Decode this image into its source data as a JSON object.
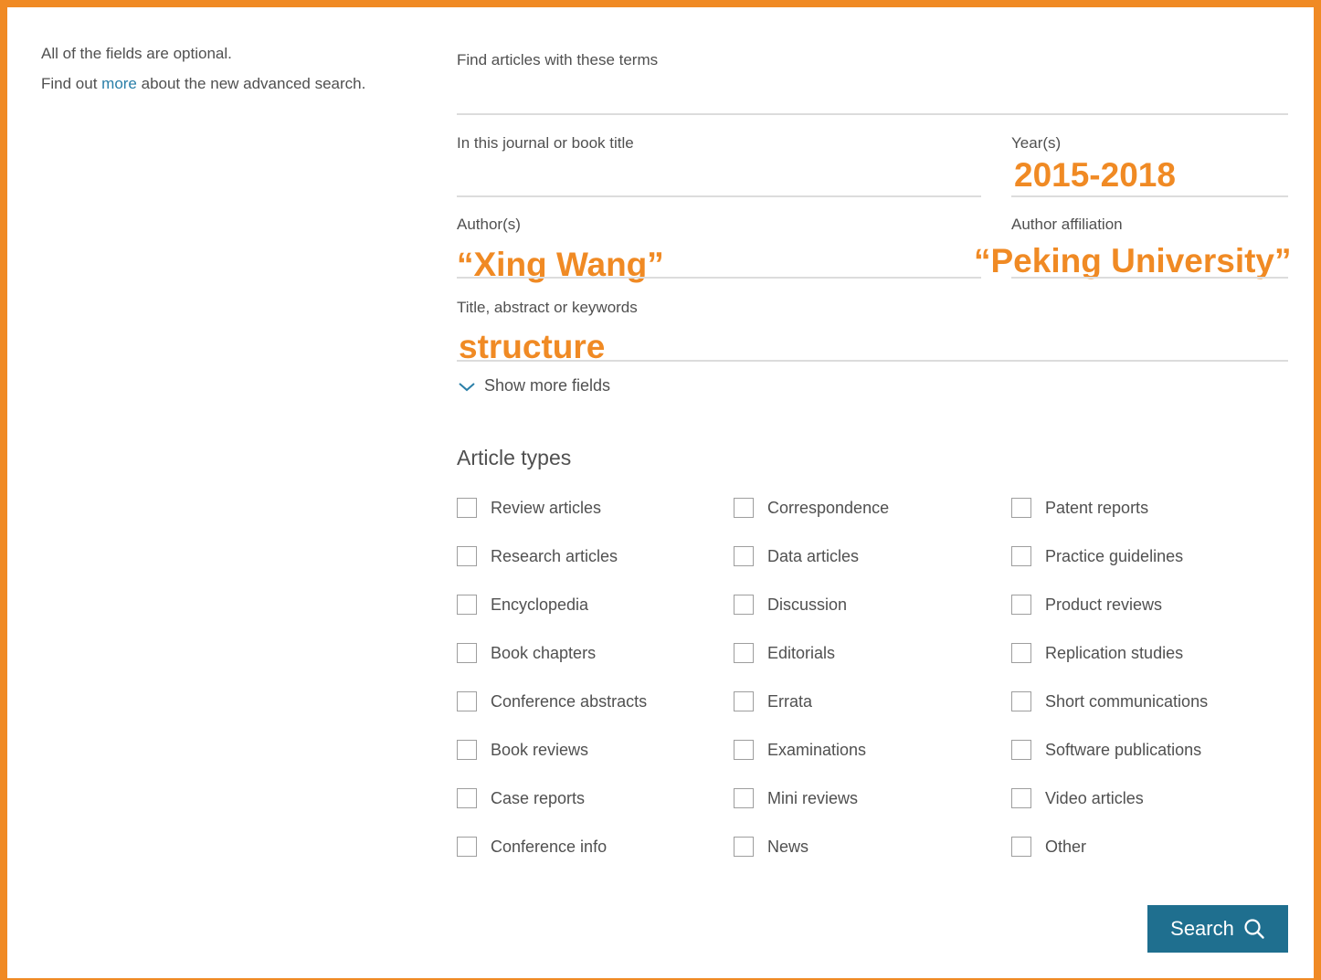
{
  "intro": {
    "line1": "All of the fields are optional.",
    "line2_prefix": "Find out ",
    "line2_link": "more",
    "line2_suffix": " about the new advanced search."
  },
  "fields": {
    "terms": {
      "label": "Find articles with these terms",
      "value": ""
    },
    "journal": {
      "label": "In this journal or book title",
      "value": ""
    },
    "years": {
      "label": "Year(s)",
      "value": "2015-2018"
    },
    "authors": {
      "label": "Author(s)",
      "value": "“Xing Wang”"
    },
    "affiliation": {
      "label": "Author affiliation",
      "value": "“Peking University”"
    },
    "keywords": {
      "label": "Title, abstract or keywords",
      "value": "structure"
    }
  },
  "show_more": "Show more fields",
  "article_types": {
    "heading": "Article types",
    "columns": [
      [
        "Review articles",
        "Research articles",
        "Encyclopedia",
        "Book chapters",
        "Conference abstracts",
        "Book reviews",
        "Case reports",
        "Conference info"
      ],
      [
        "Correspondence",
        "Data articles",
        "Discussion",
        "Editorials",
        "Errata",
        "Examinations",
        "Mini reviews",
        "News"
      ],
      [
        "Patent reports",
        "Practice guidelines",
        "Product reviews",
        "Replication studies",
        "Short communications",
        "Software publications",
        "Video articles",
        "Other"
      ]
    ]
  },
  "search_button": {
    "label": "Search",
    "icon": "search-icon"
  },
  "colors": {
    "accent": "#f08a24",
    "link": "#2a7fa8",
    "button": "#1f6f8f"
  }
}
